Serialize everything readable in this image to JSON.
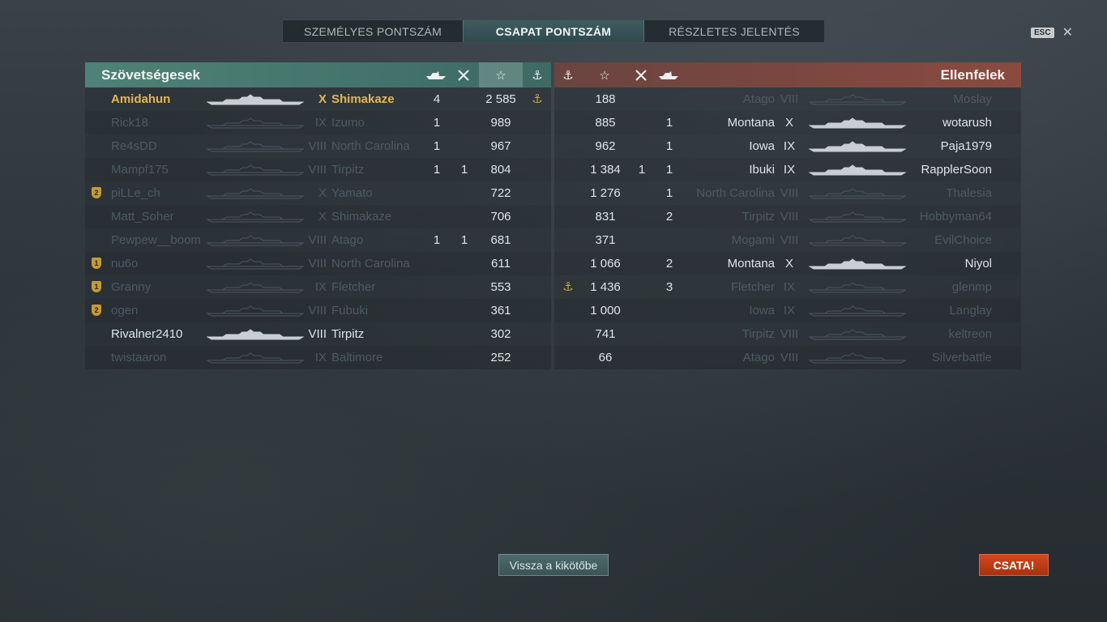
{
  "tabs": [
    {
      "label": "SZEMÉLYES PONTSZÁM"
    },
    {
      "label": "CSAPAT PONTSZÁM"
    },
    {
      "label": "RÉSZLETES JELENTÉS"
    }
  ],
  "esc": {
    "key": "ESC",
    "close": "✕"
  },
  "allies": {
    "title": "Szövetségesek",
    "icons": {
      "ships": "ship-kills-icon",
      "planes": "plane-kills-icon",
      "score": "star-icon",
      "base": "anchor-icon"
    },
    "players": [
      {
        "name": "Amidahun",
        "tier": "X",
        "ship": "Shimakaze",
        "kills": "4",
        "planes": "",
        "score": "2 585",
        "anchor": "⚓",
        "style": "hl",
        "badge": ""
      },
      {
        "name": "Rick18",
        "tier": "IX",
        "ship": "Izumo",
        "kills": "1",
        "planes": "",
        "score": "989",
        "anchor": "",
        "style": "dim",
        "badge": ""
      },
      {
        "name": "Re4sDD",
        "tier": "VIII",
        "ship": "North Carolina",
        "kills": "1",
        "planes": "",
        "score": "967",
        "anchor": "",
        "style": "dim",
        "badge": ""
      },
      {
        "name": "Mampf175",
        "tier": "VIII",
        "ship": "Tirpitz",
        "kills": "1",
        "planes": "1",
        "score": "804",
        "anchor": "",
        "style": "dim",
        "badge": ""
      },
      {
        "name": "piLLe_ch",
        "tier": "X",
        "ship": "Yamato",
        "kills": "",
        "planes": "",
        "score": "722",
        "anchor": "",
        "style": "dim",
        "badge": "2"
      },
      {
        "name": "Matt_Soher",
        "tier": "X",
        "ship": "Shimakaze",
        "kills": "",
        "planes": "",
        "score": "706",
        "anchor": "",
        "style": "dim",
        "badge": ""
      },
      {
        "name": "Pewpew__boom",
        "tier": "VIII",
        "ship": "Atago",
        "kills": "1",
        "planes": "1",
        "score": "681",
        "anchor": "",
        "style": "dim",
        "badge": ""
      },
      {
        "name": "nu6o",
        "tier": "VIII",
        "ship": "North Carolina",
        "kills": "",
        "planes": "",
        "score": "611",
        "anchor": "",
        "style": "dim",
        "badge": "1"
      },
      {
        "name": "Granny",
        "tier": "IX",
        "ship": "Fletcher",
        "kills": "",
        "planes": "",
        "score": "553",
        "anchor": "",
        "style": "dim",
        "badge": "1"
      },
      {
        "name": "ogen",
        "tier": "VIII",
        "ship": "Fubuki",
        "kills": "",
        "planes": "",
        "score": "361",
        "anchor": "",
        "style": "dim",
        "badge": "2"
      },
      {
        "name": "Rivalner2410",
        "tier": "VIII",
        "ship": "Tirpitz",
        "kills": "",
        "planes": "",
        "score": "302",
        "anchor": "",
        "style": "norm",
        "badge": ""
      },
      {
        "name": "twistaaron",
        "tier": "IX",
        "ship": "Baltimore",
        "kills": "",
        "planes": "",
        "score": "252",
        "anchor": "",
        "style": "dim",
        "badge": ""
      }
    ]
  },
  "enemies": {
    "title": "Ellenfelek",
    "players": [
      {
        "anchor": "",
        "score": "188",
        "planes": "",
        "kills": "",
        "ship": "Atago",
        "tier": "VIII",
        "name": "Moslay",
        "style": "dim"
      },
      {
        "anchor": "",
        "score": "885",
        "planes": "",
        "kills": "1",
        "ship": "Montana",
        "tier": "X",
        "name": "wotarush",
        "style": "norm"
      },
      {
        "anchor": "",
        "score": "962",
        "planes": "",
        "kills": "1",
        "ship": "Iowa",
        "tier": "IX",
        "name": "Paja1979",
        "style": "norm"
      },
      {
        "anchor": "",
        "score": "1 384",
        "planes": "1",
        "kills": "1",
        "ship": "Ibuki",
        "tier": "IX",
        "name": "RapplerSoon",
        "style": "norm"
      },
      {
        "anchor": "",
        "score": "1 276",
        "planes": "",
        "kills": "1",
        "ship": "North Carolina",
        "tier": "VIII",
        "name": "Thalesia",
        "style": "dim"
      },
      {
        "anchor": "",
        "score": "831",
        "planes": "",
        "kills": "2",
        "ship": "Tirpitz",
        "tier": "VIII",
        "name": "Hobbyman64",
        "style": "dim"
      },
      {
        "anchor": "",
        "score": "371",
        "planes": "",
        "kills": "",
        "ship": "Mogami",
        "tier": "VIII",
        "name": "EvilChoice",
        "style": "dim"
      },
      {
        "anchor": "",
        "score": "1 066",
        "planes": "",
        "kills": "2",
        "ship": "Montana",
        "tier": "X",
        "name": "Niyol",
        "style": "norm"
      },
      {
        "anchor": "⚓",
        "score": "1 436",
        "planes": "",
        "kills": "3",
        "ship": "Fletcher",
        "tier": "IX",
        "name": "glenmp",
        "style": "dim"
      },
      {
        "anchor": "",
        "score": "1 000",
        "planes": "",
        "kills": "",
        "ship": "Iowa",
        "tier": "IX",
        "name": "Langlay",
        "style": "dim"
      },
      {
        "anchor": "",
        "score": "741",
        "planes": "",
        "kills": "",
        "ship": "Tirpitz",
        "tier": "VIII",
        "name": "keltreon",
        "style": "dim"
      },
      {
        "anchor": "",
        "score": "66",
        "planes": "",
        "kills": "",
        "ship": "Atago",
        "tier": "VIII",
        "name": "Silverbattle",
        "style": "dim"
      }
    ]
  },
  "buttons": {
    "back": "Vissza a kikötőbe",
    "battle": "CSATA!"
  }
}
